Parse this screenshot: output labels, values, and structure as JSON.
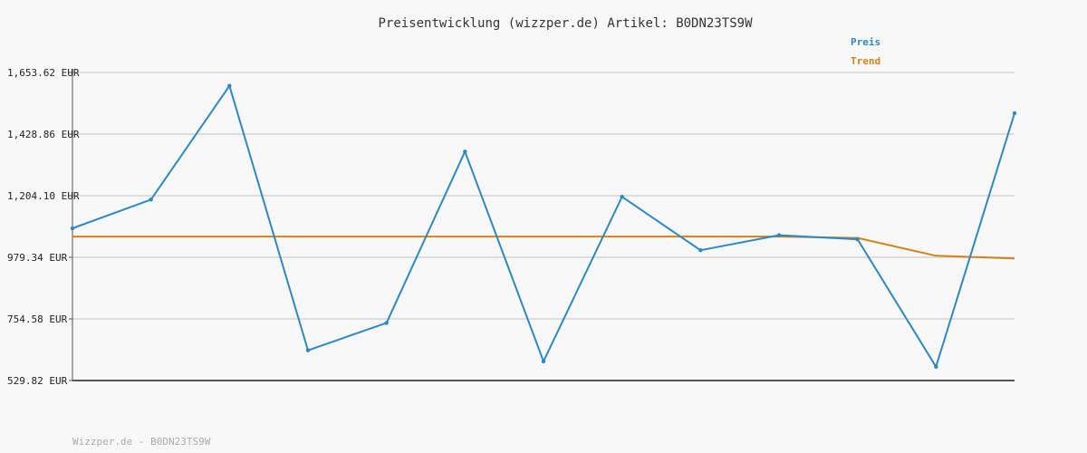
{
  "colors": {
    "price": "#2a8ac8",
    "trend": "#d4821c",
    "grid": "#dddddd",
    "axis": "#555555"
  },
  "chart_data": {
    "type": "line",
    "title": "Preisentwicklung (wizzper.de) Artikel: B0DN23TS9W",
    "ylim": [
      529.82,
      1653.62
    ],
    "yticks": [
      "1,653.62 EUR",
      "1,428.86 EUR",
      "1,204.10 EUR",
      "979.34 EUR",
      "754.58 EUR",
      "529.82 EUR"
    ],
    "ytick_values": [
      1653.62,
      1428.86,
      1204.1,
      979.34,
      754.58,
      529.82
    ],
    "grid": true,
    "legend_position": "top-right",
    "series": [
      {
        "name": "Preis",
        "values": [
          1085,
          1190,
          1605,
          640,
          740,
          1365,
          600,
          1200,
          1005,
          1060,
          1045,
          580,
          1505
        ]
      },
      {
        "name": "Trend",
        "values": [
          1055,
          1055,
          1055,
          1055,
          1055,
          1055,
          1055,
          1055,
          1055,
          1055,
          1050,
          985,
          975
        ]
      }
    ]
  },
  "footer": "Wizzper.de - B0DN23TS9W"
}
